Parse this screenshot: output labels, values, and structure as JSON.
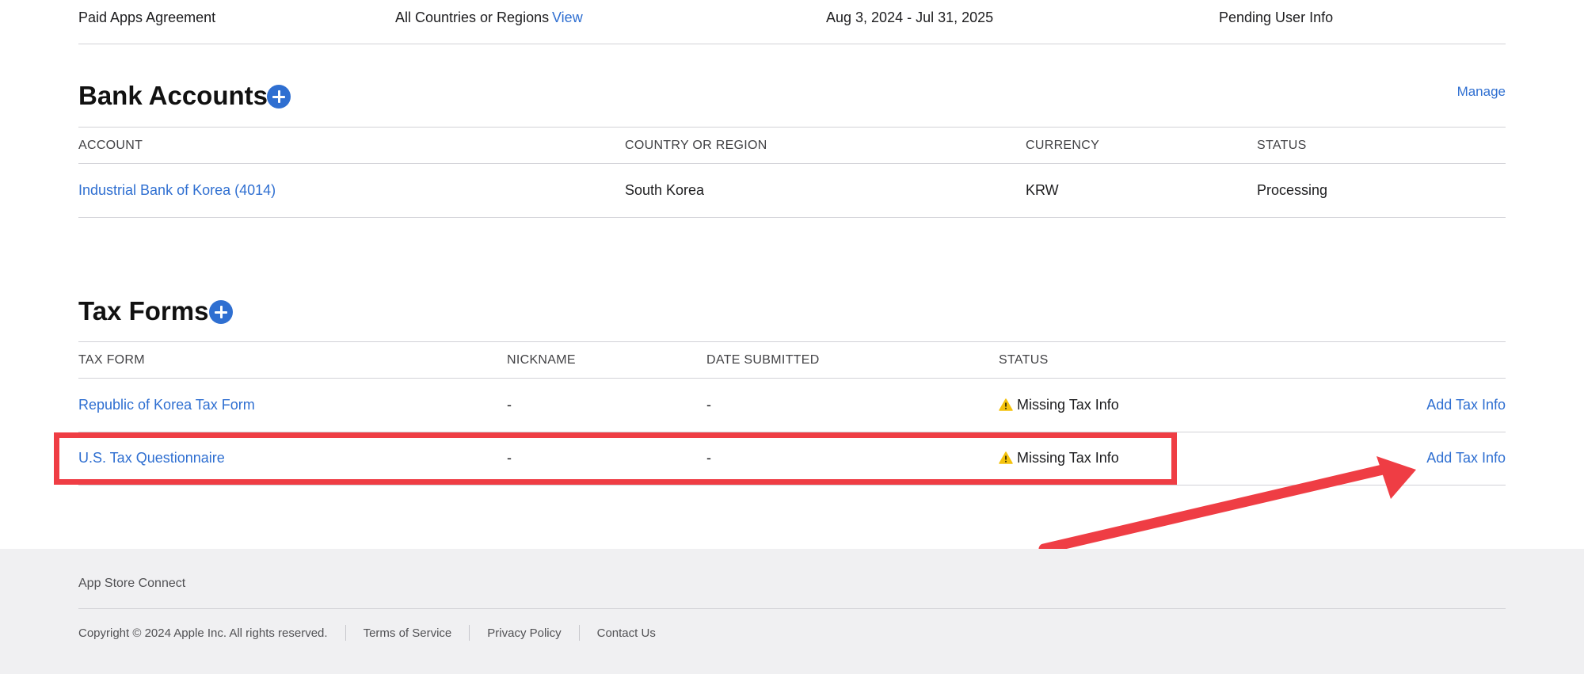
{
  "agreement_row": {
    "name": "Paid Apps Agreement",
    "countries": "All Countries or Regions",
    "view_link": "View",
    "dates": "Aug 3, 2024 - Jul 31, 2025",
    "status": "Pending User Info"
  },
  "bank_accounts": {
    "title": "Bank Accounts",
    "manage_link": "Manage",
    "headers": {
      "account": "ACCOUNT",
      "country": "COUNTRY OR REGION",
      "currency": "CURRENCY",
      "status": "STATUS"
    },
    "rows": [
      {
        "account": "Industrial Bank of Korea (4014)",
        "country": "South Korea",
        "currency": "KRW",
        "status": "Processing"
      }
    ]
  },
  "tax_forms": {
    "title": "Tax Forms",
    "headers": {
      "form": "TAX FORM",
      "nickname": "NICKNAME",
      "date": "DATE SUBMITTED",
      "status": "STATUS"
    },
    "rows": [
      {
        "form": "Republic of Korea Tax Form",
        "nickname": "-",
        "date": "-",
        "status": "Missing Tax Info",
        "action": "Add Tax Info"
      },
      {
        "form": "U.S. Tax Questionnaire",
        "nickname": "-",
        "date": "-",
        "status": "Missing Tax Info",
        "action": "Add Tax Info"
      }
    ]
  },
  "footer": {
    "brand": "App Store Connect",
    "copyright": "Copyright © 2024 Apple Inc. All rights reserved.",
    "terms": "Terms of Service",
    "privacy": "Privacy Policy",
    "contact": "Contact Us"
  },
  "colors": {
    "link": "#2f6fd1",
    "warning": "#f4c20d",
    "annotation": "#ef3d44",
    "footer_bg": "#f0f0f2"
  },
  "icons": {
    "add": "plus-circle-icon",
    "warning": "warning-triangle-icon",
    "annotation_arrow": "arrow-annotation"
  }
}
